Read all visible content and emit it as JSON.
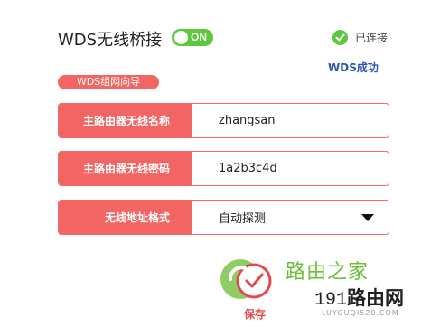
{
  "header": {
    "title": "WDS无线桥接",
    "toggle_label": "ON",
    "toggle_state": "on",
    "status_text": "已连接",
    "result_text": "WDS成功"
  },
  "wizard": {
    "label": "WDS组网向导"
  },
  "form": {
    "ssid": {
      "label": "主路由器无线名称",
      "value": "zhangsan"
    },
    "password": {
      "label": "主路由器无线密码",
      "value": "1a2b3c4d"
    },
    "address_format": {
      "label": "无线地址格式",
      "value": "自动探测"
    }
  },
  "save": {
    "label": "保存",
    "icon": "save-check-icon"
  },
  "watermark": {
    "line1": "路由之家",
    "line2_prefix": "191",
    "line2": "路由网",
    "line3": "LUYOUQI520.COM"
  },
  "colors": {
    "accent": "#f26563",
    "toggle_on": "#5cc93c",
    "link": "#2f55b3"
  }
}
